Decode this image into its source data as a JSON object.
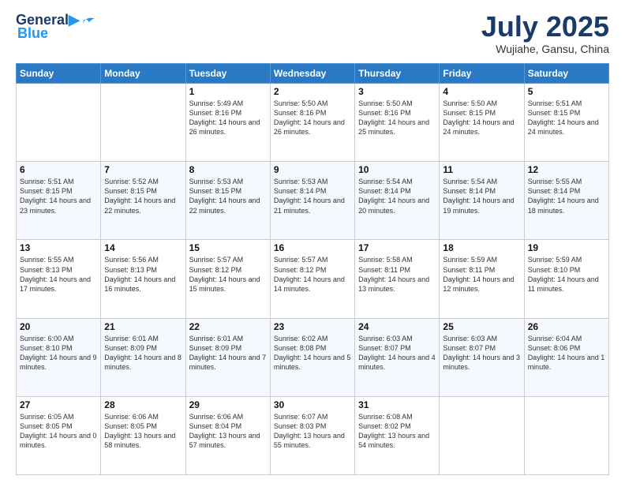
{
  "header": {
    "logo_line1": "General",
    "logo_line2": "Blue",
    "month_title": "July 2025",
    "subtitle": "Wujiahe, Gansu, China"
  },
  "weekdays": [
    "Sunday",
    "Monday",
    "Tuesday",
    "Wednesday",
    "Thursday",
    "Friday",
    "Saturday"
  ],
  "weeks": [
    [
      {
        "day": "",
        "info": ""
      },
      {
        "day": "",
        "info": ""
      },
      {
        "day": "1",
        "info": "Sunrise: 5:49 AM\nSunset: 8:16 PM\nDaylight: 14 hours and 26 minutes."
      },
      {
        "day": "2",
        "info": "Sunrise: 5:50 AM\nSunset: 8:16 PM\nDaylight: 14 hours and 26 minutes."
      },
      {
        "day": "3",
        "info": "Sunrise: 5:50 AM\nSunset: 8:16 PM\nDaylight: 14 hours and 25 minutes."
      },
      {
        "day": "4",
        "info": "Sunrise: 5:50 AM\nSunset: 8:15 PM\nDaylight: 14 hours and 24 minutes."
      },
      {
        "day": "5",
        "info": "Sunrise: 5:51 AM\nSunset: 8:15 PM\nDaylight: 14 hours and 24 minutes."
      }
    ],
    [
      {
        "day": "6",
        "info": "Sunrise: 5:51 AM\nSunset: 8:15 PM\nDaylight: 14 hours and 23 minutes."
      },
      {
        "day": "7",
        "info": "Sunrise: 5:52 AM\nSunset: 8:15 PM\nDaylight: 14 hours and 22 minutes."
      },
      {
        "day": "8",
        "info": "Sunrise: 5:53 AM\nSunset: 8:15 PM\nDaylight: 14 hours and 22 minutes."
      },
      {
        "day": "9",
        "info": "Sunrise: 5:53 AM\nSunset: 8:14 PM\nDaylight: 14 hours and 21 minutes."
      },
      {
        "day": "10",
        "info": "Sunrise: 5:54 AM\nSunset: 8:14 PM\nDaylight: 14 hours and 20 minutes."
      },
      {
        "day": "11",
        "info": "Sunrise: 5:54 AM\nSunset: 8:14 PM\nDaylight: 14 hours and 19 minutes."
      },
      {
        "day": "12",
        "info": "Sunrise: 5:55 AM\nSunset: 8:14 PM\nDaylight: 14 hours and 18 minutes."
      }
    ],
    [
      {
        "day": "13",
        "info": "Sunrise: 5:55 AM\nSunset: 8:13 PM\nDaylight: 14 hours and 17 minutes."
      },
      {
        "day": "14",
        "info": "Sunrise: 5:56 AM\nSunset: 8:13 PM\nDaylight: 14 hours and 16 minutes."
      },
      {
        "day": "15",
        "info": "Sunrise: 5:57 AM\nSunset: 8:12 PM\nDaylight: 14 hours and 15 minutes."
      },
      {
        "day": "16",
        "info": "Sunrise: 5:57 AM\nSunset: 8:12 PM\nDaylight: 14 hours and 14 minutes."
      },
      {
        "day": "17",
        "info": "Sunrise: 5:58 AM\nSunset: 8:11 PM\nDaylight: 14 hours and 13 minutes."
      },
      {
        "day": "18",
        "info": "Sunrise: 5:59 AM\nSunset: 8:11 PM\nDaylight: 14 hours and 12 minutes."
      },
      {
        "day": "19",
        "info": "Sunrise: 5:59 AM\nSunset: 8:10 PM\nDaylight: 14 hours and 11 minutes."
      }
    ],
    [
      {
        "day": "20",
        "info": "Sunrise: 6:00 AM\nSunset: 8:10 PM\nDaylight: 14 hours and 9 minutes."
      },
      {
        "day": "21",
        "info": "Sunrise: 6:01 AM\nSunset: 8:09 PM\nDaylight: 14 hours and 8 minutes."
      },
      {
        "day": "22",
        "info": "Sunrise: 6:01 AM\nSunset: 8:09 PM\nDaylight: 14 hours and 7 minutes."
      },
      {
        "day": "23",
        "info": "Sunrise: 6:02 AM\nSunset: 8:08 PM\nDaylight: 14 hours and 5 minutes."
      },
      {
        "day": "24",
        "info": "Sunrise: 6:03 AM\nSunset: 8:07 PM\nDaylight: 14 hours and 4 minutes."
      },
      {
        "day": "25",
        "info": "Sunrise: 6:03 AM\nSunset: 8:07 PM\nDaylight: 14 hours and 3 minutes."
      },
      {
        "day": "26",
        "info": "Sunrise: 6:04 AM\nSunset: 8:06 PM\nDaylight: 14 hours and 1 minute."
      }
    ],
    [
      {
        "day": "27",
        "info": "Sunrise: 6:05 AM\nSunset: 8:05 PM\nDaylight: 14 hours and 0 minutes."
      },
      {
        "day": "28",
        "info": "Sunrise: 6:06 AM\nSunset: 8:05 PM\nDaylight: 13 hours and 58 minutes."
      },
      {
        "day": "29",
        "info": "Sunrise: 6:06 AM\nSunset: 8:04 PM\nDaylight: 13 hours and 57 minutes."
      },
      {
        "day": "30",
        "info": "Sunrise: 6:07 AM\nSunset: 8:03 PM\nDaylight: 13 hours and 55 minutes."
      },
      {
        "day": "31",
        "info": "Sunrise: 6:08 AM\nSunset: 8:02 PM\nDaylight: 13 hours and 54 minutes."
      },
      {
        "day": "",
        "info": ""
      },
      {
        "day": "",
        "info": ""
      }
    ]
  ]
}
